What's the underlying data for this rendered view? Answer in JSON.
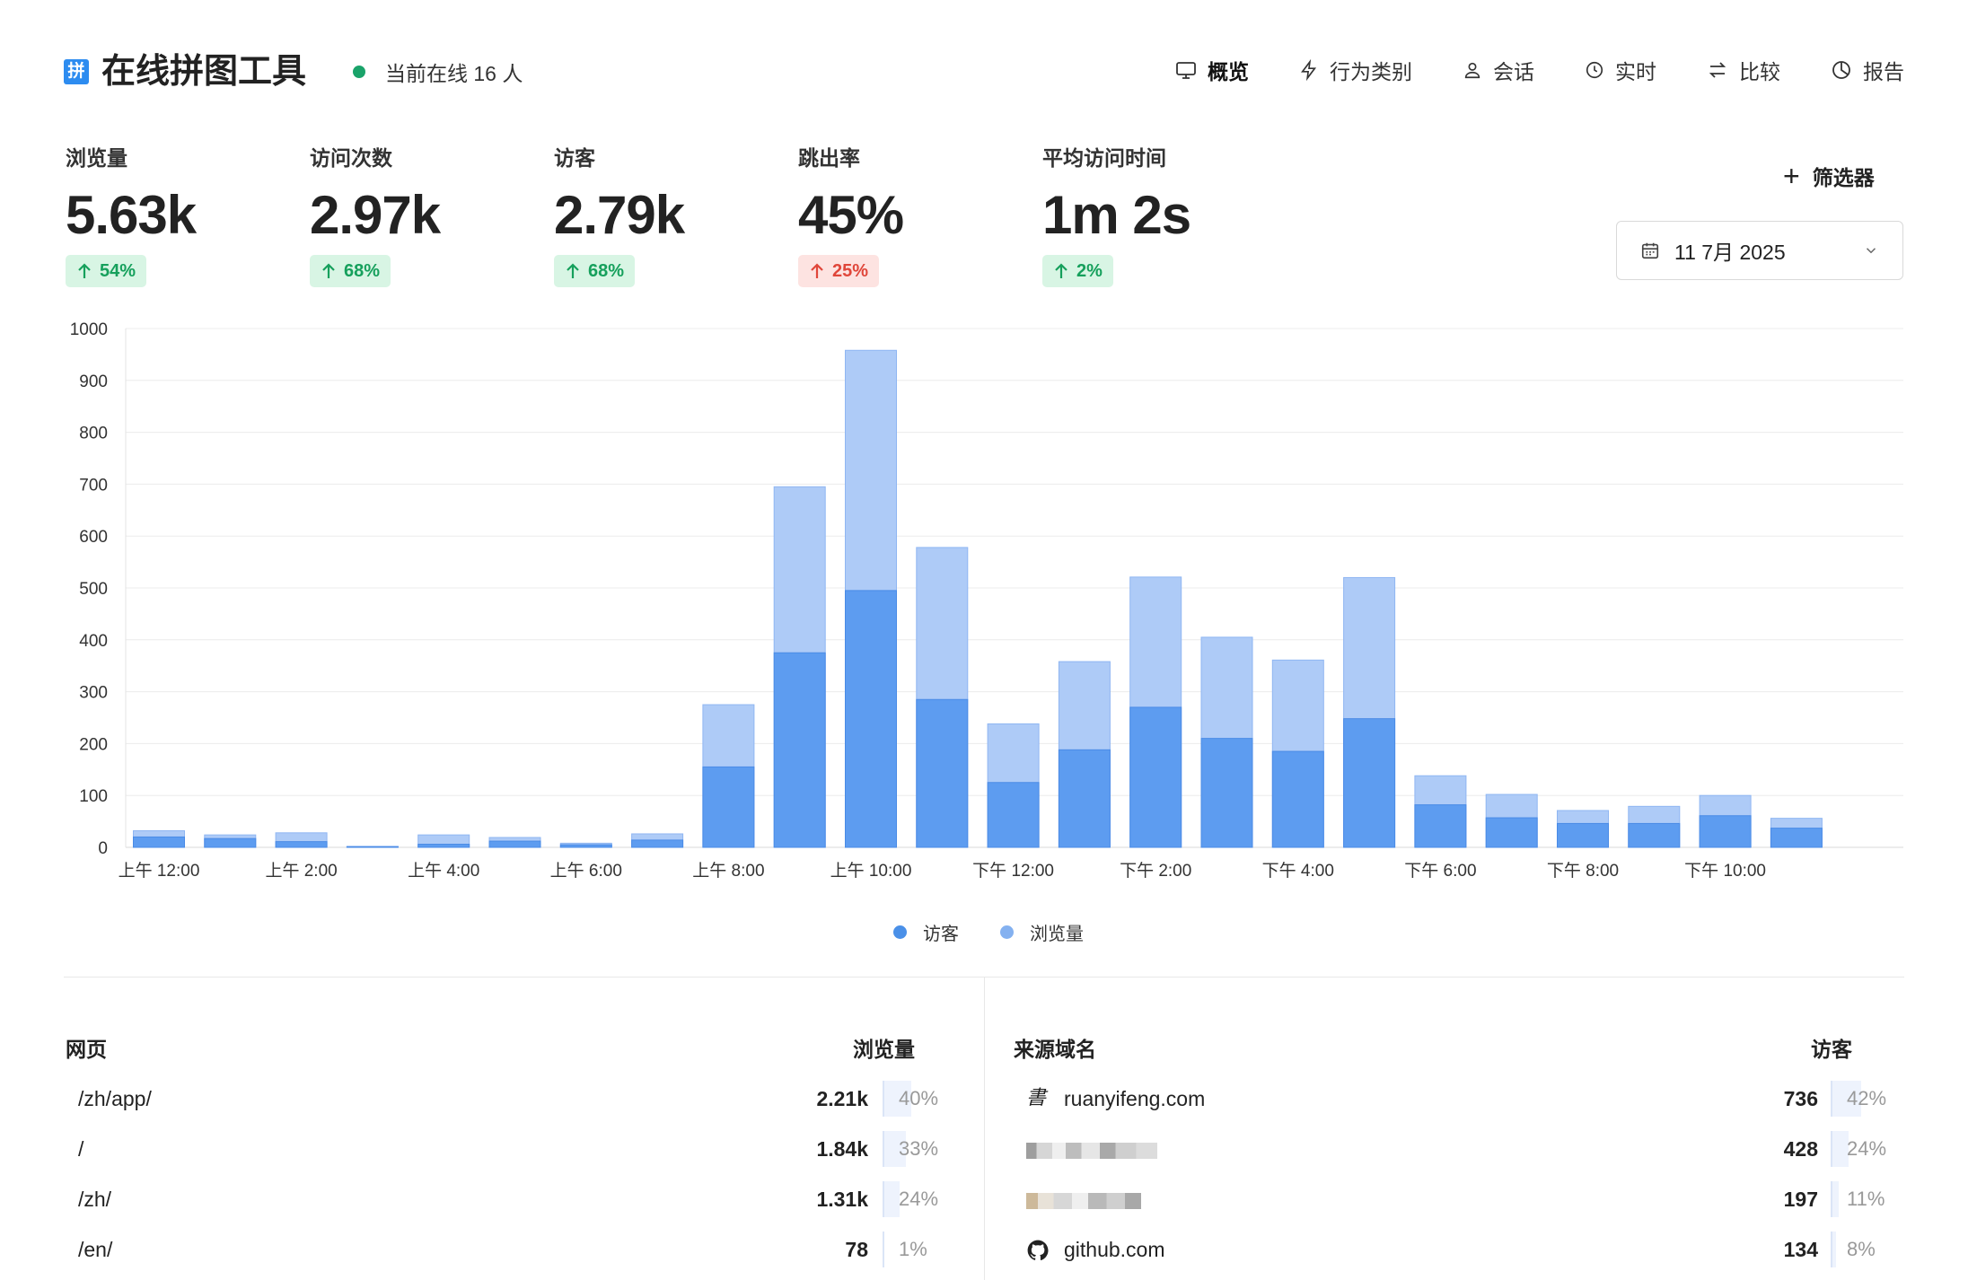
{
  "header": {
    "logo_char": "拼",
    "title": "在线拼图工具",
    "online_text": "当前在线 16 人",
    "nav": [
      {
        "label": "概览",
        "icon": "monitor-icon",
        "active": true
      },
      {
        "label": "行为类别",
        "icon": "lightning-icon",
        "active": false
      },
      {
        "label": "会话",
        "icon": "user-icon",
        "active": false
      },
      {
        "label": "实时",
        "icon": "clock-icon",
        "active": false
      },
      {
        "label": "比较",
        "icon": "swap-arrows-icon",
        "active": false
      },
      {
        "label": "报告",
        "icon": "pie-chart-icon",
        "active": false
      }
    ]
  },
  "metrics": [
    {
      "label": "浏览量",
      "value": "5.63k",
      "change": "54%",
      "direction": "up",
      "status": "good"
    },
    {
      "label": "访问次数",
      "value": "2.97k",
      "change": "68%",
      "direction": "up",
      "status": "good"
    },
    {
      "label": "访客",
      "value": "2.79k",
      "change": "68%",
      "direction": "up",
      "status": "good"
    },
    {
      "label": "跳出率",
      "value": "45%",
      "change": "25%",
      "direction": "up",
      "status": "bad"
    },
    {
      "label": "平均访问时间",
      "value": "1m 2s",
      "change": "2%",
      "direction": "up",
      "status": "good"
    }
  ],
  "filter": {
    "label": "筛选器"
  },
  "date_picker": {
    "value": "11 7月 2025"
  },
  "colors": {
    "visitors": "#4a90e8",
    "pageviews": "#a8c8f8",
    "good_text": "#16a05c",
    "bad_text": "#e0463a",
    "online_dot": "#1aa36a"
  },
  "chart_data": {
    "type": "bar",
    "stacked": true,
    "x_tick_labels": [
      "上午 12:00",
      "上午 2:00",
      "上午 4:00",
      "上午 6:00",
      "上午 8:00",
      "上午 10:00",
      "下午 12:00",
      "下午 2:00",
      "下午 4:00",
      "下午 6:00",
      "下午 8:00",
      "下午 10:00"
    ],
    "hours": 24,
    "ylim": [
      0,
      1000
    ],
    "yticks": [
      0,
      100,
      200,
      300,
      400,
      500,
      600,
      700,
      800,
      900,
      1000
    ],
    "grid": true,
    "legend_position": "bottom-center",
    "series": [
      {
        "name": "访客",
        "values": [
          20,
          17,
          11,
          1,
          6,
          12,
          5,
          14,
          155,
          375,
          495,
          285,
          125,
          188,
          270,
          210,
          185,
          248,
          82,
          57,
          46,
          46,
          61,
          37
        ]
      },
      {
        "name": "浏览量",
        "values": [
          32,
          24,
          28,
          2,
          24,
          19,
          8,
          26,
          275,
          695,
          958,
          578,
          238,
          358,
          521,
          405,
          361,
          520,
          138,
          102,
          71,
          79,
          100,
          56
        ]
      }
    ]
  },
  "pages_table": {
    "title": "网页",
    "metric_label": "浏览量",
    "rows": [
      {
        "name": "/zh/app/",
        "value": "2.21k",
        "percent": "40%",
        "share": 0.4
      },
      {
        "name": "/",
        "value": "1.84k",
        "percent": "33%",
        "share": 0.33
      },
      {
        "name": "/zh/",
        "value": "1.31k",
        "percent": "24%",
        "share": 0.24
      },
      {
        "name": "/en/",
        "value": "78",
        "percent": "1%",
        "share": 0.01
      }
    ]
  },
  "referrers_table": {
    "title": "来源域名",
    "metric_label": "访客",
    "rows": [
      {
        "name": "ruanyifeng.com",
        "icon": "ruanyifeng-favicon-icon",
        "value": "736",
        "percent": "42%",
        "share": 0.42
      },
      {
        "name": "",
        "icon": "blurred-favicon-icon",
        "value": "428",
        "percent": "24%",
        "share": 0.24
      },
      {
        "name": "",
        "icon": "blurred-favicon-icon",
        "value": "197",
        "percent": "11%",
        "share": 0.11
      },
      {
        "name": "github.com",
        "icon": "github-icon",
        "value": "134",
        "percent": "8%",
        "share": 0.08
      }
    ]
  }
}
